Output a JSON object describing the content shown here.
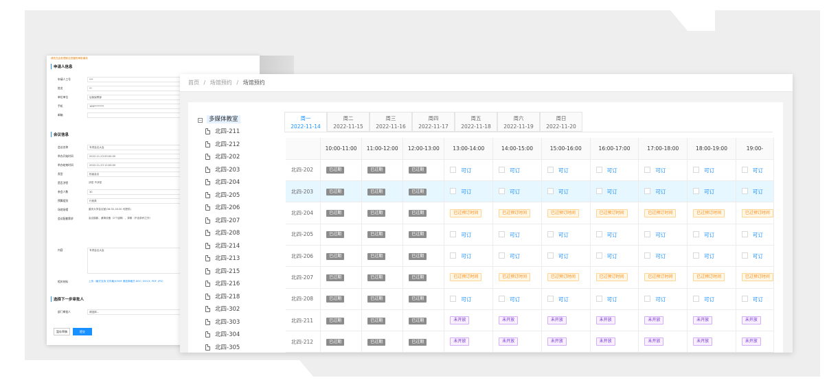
{
  "breadcrumb": {
    "home": "首页",
    "sep": "/",
    "level2": "场馆预约",
    "current": "场馆预约"
  },
  "tree": {
    "root": "多媒体教室",
    "items": [
      "北四-211",
      "北四-212",
      "北四-202",
      "北四-203",
      "北四-204",
      "北四-205",
      "北四-206",
      "北四-207",
      "北四-208",
      "北四-214",
      "北四-213",
      "北四-215",
      "北四-216",
      "北四-218",
      "北四-302",
      "北四-303",
      "北四-304",
      "北四-305"
    ]
  },
  "tabs": [
    {
      "day": "周一",
      "date": "2022-11-14"
    },
    {
      "day": "周二",
      "date": "2022-11-15"
    },
    {
      "day": "周三",
      "date": "2022-11-16"
    },
    {
      "day": "周四",
      "date": "2022-11-17"
    },
    {
      "day": "周五",
      "date": "2022-11-18"
    },
    {
      "day": "周六",
      "date": "2022-11-19"
    },
    {
      "day": "周日",
      "date": "2022-11-20"
    }
  ],
  "active_tab": 0,
  "times": [
    "10:00-11:00",
    "11:00-12:00",
    "12:00-13:00",
    "13:00-14:00",
    "14:00-15:00",
    "15:00-16:00",
    "16:00-17:00",
    "17:00-18:00",
    "18:00-19:00",
    "19:00-"
  ],
  "status_labels": {
    "past": "已过期",
    "avail": "可订",
    "booked": "已过预订时间",
    "notopen": "未开放"
  },
  "rows": [
    {
      "room": "北四-202",
      "cells": [
        "past",
        "past",
        "past",
        "avail",
        "avail",
        "avail",
        "avail",
        "avail",
        "avail",
        "avail"
      ]
    },
    {
      "room": "北四-203",
      "cells": [
        "past",
        "past",
        "past",
        "avail",
        "avail",
        "avail",
        "avail",
        "avail",
        "avail",
        "avail"
      ],
      "highlight": true
    },
    {
      "room": "北四-204",
      "cells": [
        "past",
        "past",
        "past",
        "booked",
        "booked",
        "booked",
        "booked",
        "booked",
        "booked",
        "booked"
      ]
    },
    {
      "room": "北四-205",
      "cells": [
        "past",
        "past",
        "past",
        "avail",
        "avail",
        "avail",
        "avail",
        "avail",
        "avail",
        "avail"
      ]
    },
    {
      "room": "北四-206",
      "cells": [
        "past",
        "past",
        "past",
        "avail",
        "avail",
        "avail",
        "avail",
        "avail",
        "avail",
        "avail"
      ]
    },
    {
      "room": "北四-207",
      "cells": [
        "past",
        "past",
        "past",
        "booked",
        "booked",
        "booked",
        "booked",
        "booked",
        "booked",
        "booked"
      ]
    },
    {
      "room": "北四-208",
      "cells": [
        "past",
        "past",
        "past",
        "avail",
        "avail",
        "avail",
        "avail",
        "avail",
        "avail",
        "avail"
      ]
    },
    {
      "room": "北四-211",
      "cells": [
        "past",
        "past",
        "past",
        "notopen",
        "notopen",
        "notopen",
        "notopen",
        "notopen",
        "notopen",
        "notopen"
      ]
    },
    {
      "room": "北四-212",
      "cells": [
        "past",
        "past",
        "past",
        "notopen",
        "notopen",
        "notopen",
        "notopen",
        "notopen",
        "notopen",
        "notopen"
      ]
    }
  ],
  "form": {
    "hint": "请先在此处理前往您管的审批事务",
    "sections": [
      "申请人信息",
      "会议信息",
      "选择下一步审批人"
    ],
    "applicant": [
      {
        "label": "申请人工号",
        "value": "***"
      },
      {
        "label": "姓名",
        "value": "**"
      },
      {
        "label": "单位单位",
        "value": "后勤保障部"
      },
      {
        "label": "手机",
        "value": "186********"
      },
      {
        "label": "邮箱",
        "value": ""
      }
    ],
    "meeting": [
      {
        "label": "会议名称",
        "value": "专项会议大会"
      },
      {
        "label": "举办开始时间",
        "value": "2022-11-23 09:00:00"
      },
      {
        "label": "举办结束时间",
        "value": "2022-11-23 12:00:00"
      },
      {
        "label": "类型",
        "value": "校级会议"
      },
      {
        "label": "是否涉密",
        "value": "涉密   不涉密"
      },
      {
        "label": "参会人数",
        "value": "30"
      },
      {
        "label": "预算组别",
        "value": "行政类"
      },
      {
        "label": "场地场馆",
        "value": "重庆大学会议室(08:30-16:30 可提供)"
      },
      {
        "label": "会议配套需求",
        "value": "会议摄影、桌椅设备（2个话筒）、茶歇（不含茶杯之外）"
      }
    ],
    "content_label": "内容",
    "content_value": "专项会议大会",
    "attach_label": "相关材料",
    "attach_value": "上传（格式支持 文件最大50M 请选择格式 DOC, DOCX, PDF, JPG）",
    "approver_label": "部门审批人",
    "approver_value": "请选择...",
    "btn_save": "暂存草稿",
    "btn_submit": "提交"
  }
}
